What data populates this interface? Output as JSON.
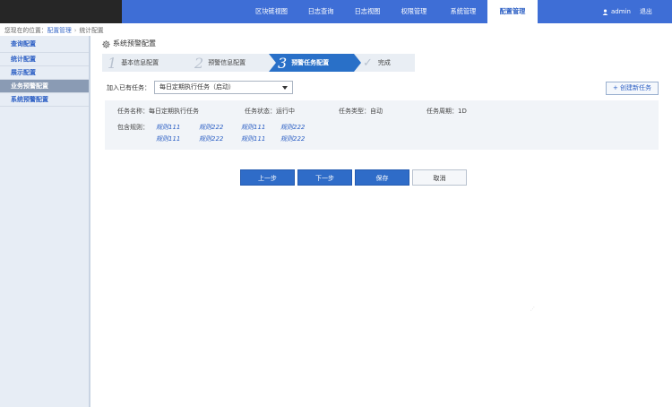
{
  "nav": {
    "items": [
      "区块链视图",
      "日志查询",
      "日志视图",
      "权限管理",
      "系统管理",
      "配置管理"
    ],
    "active_index": 5
  },
  "user": {
    "name": "admin",
    "logout": "退出"
  },
  "breadcrumb": {
    "prefix": "您现在的位置：",
    "parent": "配置管理",
    "current": "统计配置"
  },
  "sidebar": {
    "items": [
      "查询配置",
      "统计配置",
      "展示配置",
      "业务预警配置",
      "系统预警配置"
    ],
    "active_index": 3
  },
  "page": {
    "title": "系统预警配置"
  },
  "steps": [
    {
      "num": "1",
      "label": "基本信息配置"
    },
    {
      "num": "2",
      "label": "预警信息配置"
    },
    {
      "num": "3",
      "label": "预警任务配置"
    },
    {
      "num": "",
      "label": "完成"
    }
  ],
  "active_step": 2,
  "join": {
    "label": "加入已有任务：",
    "selected": "每日定期执行任务（启动）"
  },
  "create_button": "+ 创建新任务",
  "task": {
    "name": "任务名称：每日定期执行任务",
    "status": "任务状态：运行中",
    "type": "任务类型：自动",
    "period": "任务周期：1D",
    "rules_label": "包含规则：",
    "rules": [
      "规则111",
      "规则222",
      "规则111",
      "规则222",
      "规则111",
      "规则222",
      "规则111",
      "规则222"
    ]
  },
  "buttons": {
    "prev": "上一步",
    "next": "下一步",
    "save": "保存",
    "cancel": "取消"
  },
  "colors": {
    "header": "#3e6ed6",
    "accent": "#2970c8",
    "sidebar_active": "#8a9bb4"
  }
}
